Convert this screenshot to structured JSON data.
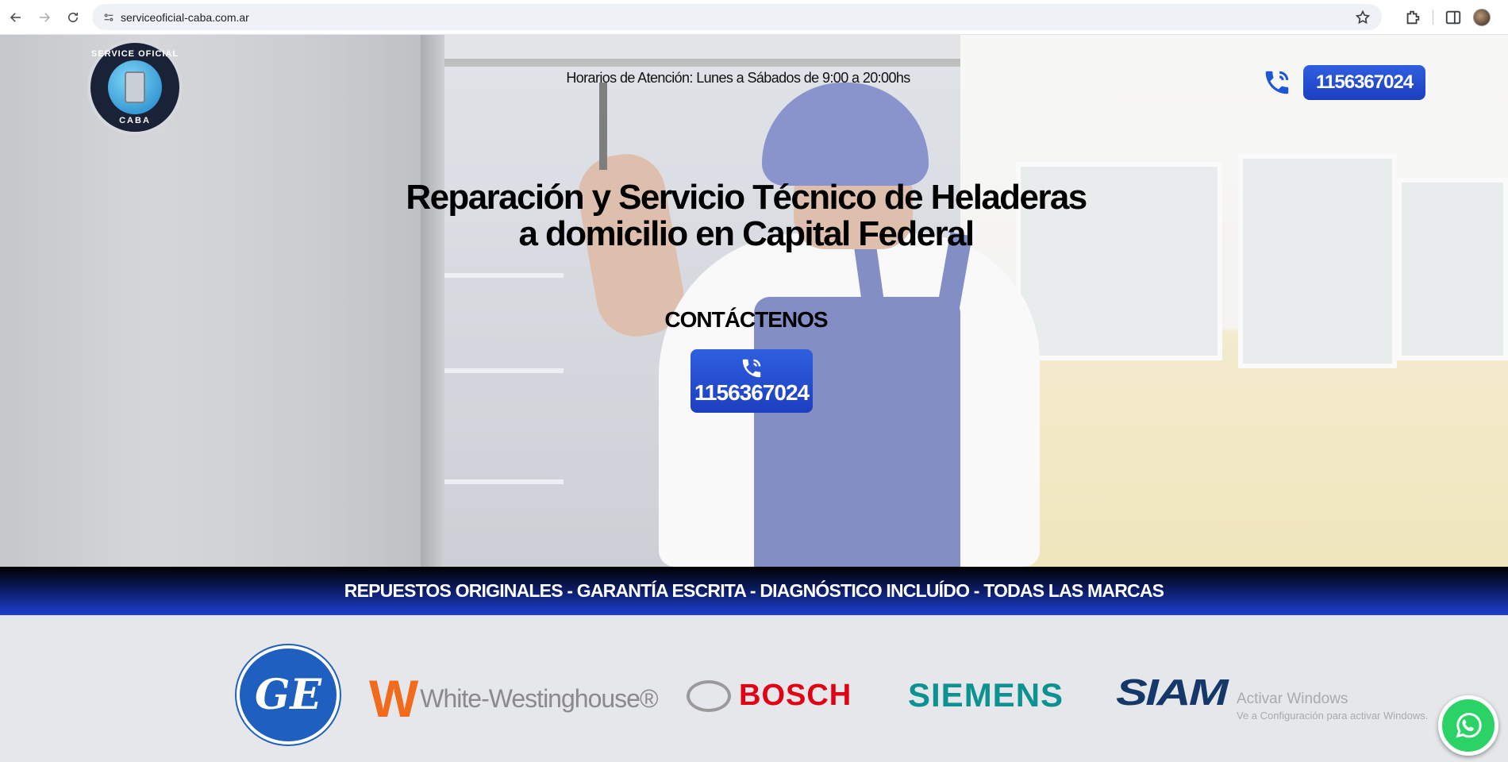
{
  "browser": {
    "url": "serviceoficial-caba.com.ar"
  },
  "header": {
    "logo_top_text": "SERVICE OFICIAL",
    "logo_bottom_text": "CABA",
    "hours": "Horarios de Atención: Lunes a Sábados de 9:00 a 20:00hs",
    "phone": "1156367024"
  },
  "hero": {
    "headline": "Reparación y Servicio Técnico de Heladeras a domicilio en Capital Federal",
    "contact_label": "CONTÁCTENOS",
    "phone": "1156367024"
  },
  "band": {
    "text": "REPUESTOS ORIGINALES - GARANTÍA ESCRITA - DIAGNÓSTICO INCLUÍDO - TODAS LAS MARCAS"
  },
  "brands": {
    "ge": "GE",
    "white_westinghouse": "White-Westinghouse®",
    "white_westinghouse_mark": "W",
    "bosch": "BOSCH",
    "siemens": "SIEMENS",
    "siam": "SIAM"
  },
  "windows_notice": {
    "title": "Activar Windows",
    "subtitle": "Ve a Configuración para activar Windows."
  },
  "colors": {
    "accent_blue": "#1c3fbf",
    "whatsapp_green": "#2bd366"
  }
}
